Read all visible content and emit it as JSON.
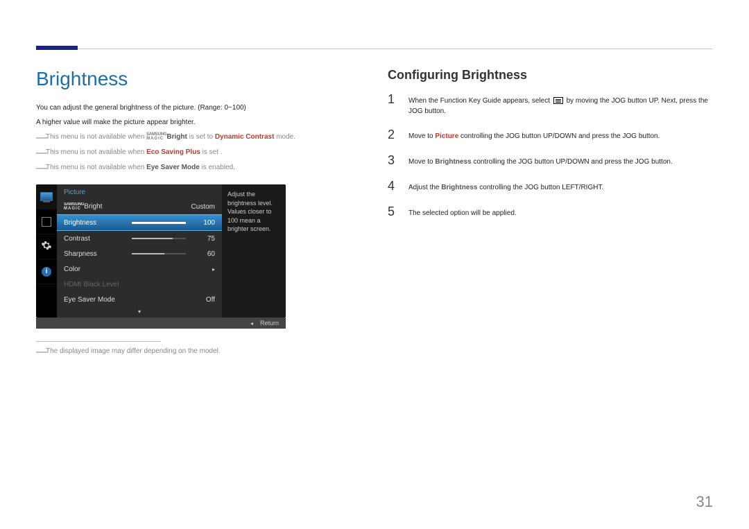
{
  "page_number": "31",
  "left": {
    "title": "Brightness",
    "intro1": "You can adjust the general brightness of the picture. (Range: 0~100)",
    "intro2": "A higher value will make the picture appear brighter.",
    "note1_pre": "This menu is not available when ",
    "note1_samsung_top": "SAMSUNG",
    "note1_samsung_bot": "MAGIC",
    "note1_bright": "Bright",
    "note1_mid": " is set to ",
    "note1_dc": "Dynamic Contrast",
    "note1_post": " mode.",
    "note2_pre": "This menu is not available when ",
    "note2_bold": "Eco Saving Plus",
    "note2_post": " is set .",
    "note3_pre": "This menu is not available when ",
    "note3_bold": "Eye Saver Mode",
    "note3_post": " is enabled.",
    "footnote": "The displayed image may differ depending on the model."
  },
  "osd": {
    "header": "Picture",
    "samsung_top": "SAMSUNG",
    "samsung_bot": "MAGIC",
    "row_magic_label": "Bright",
    "row_magic_value": "Custom",
    "row_brightness_label": "Brightness",
    "row_brightness_value": "100",
    "row_contrast_label": "Contrast",
    "row_contrast_value": "75",
    "row_sharpness_label": "Sharpness",
    "row_sharpness_value": "60",
    "row_color_label": "Color",
    "row_hdmi_label": "HDMI Black Level",
    "row_eye_label": "Eye Saver Mode",
    "row_eye_value": "Off",
    "scroll_indicator": "▾",
    "desc": "Adjust the brightness level. Values closer to 100 mean a brighter screen.",
    "footer_arrow": "◂",
    "footer_return": "Return"
  },
  "right": {
    "title": "Configuring Brightness",
    "steps": [
      {
        "num": "1",
        "pre": "When the Function Key Guide appears, select ",
        "post": " by moving the JOG button UP. Next, press the JOG button."
      },
      {
        "num": "2",
        "pre": "Move to ",
        "bold": "Picture",
        "post": " controlling the JOG button UP/DOWN and press the JOG button."
      },
      {
        "num": "3",
        "pre": "Move to ",
        "bold": "Brightness",
        "post": " controlling the JOG button UP/DOWN and press the JOG button."
      },
      {
        "num": "4",
        "pre": "Adjust the ",
        "bold": "Brightness",
        "post": " controlling the JOG button LEFT/RIGHT."
      },
      {
        "num": "5",
        "text": "The selected option will be applied."
      }
    ]
  }
}
